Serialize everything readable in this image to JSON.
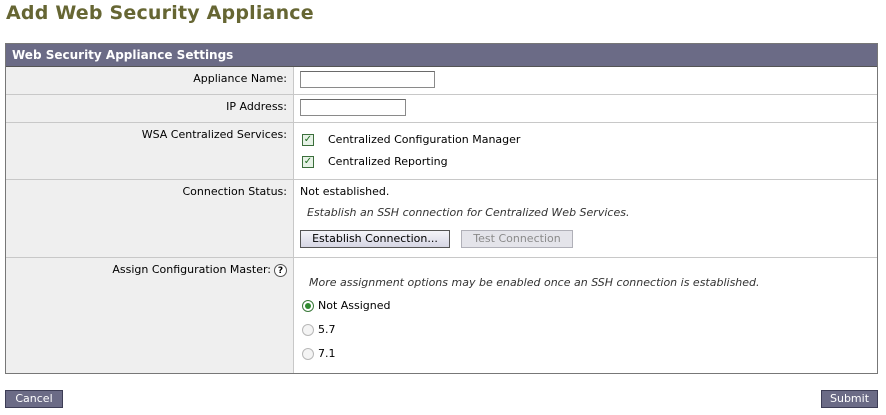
{
  "page": {
    "title": "Add Web Security Appliance"
  },
  "panel": {
    "header": "Web Security Appliance Settings",
    "appliance_name": {
      "label": "Appliance Name:",
      "value": ""
    },
    "ip_address": {
      "label": "IP Address:",
      "value": ""
    },
    "services": {
      "label": "WSA Centralized Services:",
      "items": [
        {
          "label": "Centralized Configuration Manager",
          "checked": true
        },
        {
          "label": "Centralized Reporting",
          "checked": true
        }
      ]
    },
    "connection": {
      "label": "Connection Status:",
      "status": "Not established.",
      "note": "Establish an SSH connection for Centralized Web Services.",
      "establish_label": "Establish Connection...",
      "test_label": "Test Connection"
    },
    "config_master": {
      "label": "Assign Configuration Master:",
      "help": "?",
      "note": "More assignment options may be enabled once an SSH connection is established.",
      "options": [
        {
          "label": "Not Assigned",
          "selected": true
        },
        {
          "label": "5.7",
          "selected": false
        },
        {
          "label": "7.1",
          "selected": false
        }
      ]
    }
  },
  "footer": {
    "cancel_label": "Cancel",
    "submit_label": "Submit"
  },
  "colors": {
    "title": "#666633",
    "header_bg": "#6b6b86",
    "label_bg": "#efefef",
    "check": "#2f8a2f"
  }
}
